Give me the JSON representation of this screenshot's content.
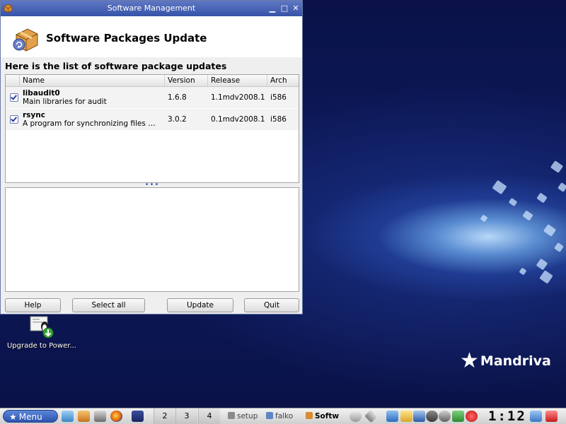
{
  "window": {
    "title": "Software Management",
    "minimize_glyph": "▁",
    "maximize_glyph": "□",
    "close_glyph": "✕"
  },
  "header": {
    "title": "Software Packages Update"
  },
  "list": {
    "subtitle": "Here is the list of software package updates",
    "columns": [
      "Name",
      "Version",
      "Release",
      "Arch"
    ],
    "rows": [
      {
        "checked": true,
        "name": "libaudit0",
        "description": "Main libraries for audit",
        "version": "1.6.8",
        "release": "1.1mdv2008.1",
        "arch": "i586"
      },
      {
        "checked": true,
        "name": "rsync",
        "description": "A program for synchronizing files ov...",
        "version": "3.0.2",
        "release": "0.1mdv2008.1",
        "arch": "i586"
      }
    ],
    "splitter_glyph": "•••"
  },
  "buttons": {
    "help": "Help",
    "select_all": "Select all",
    "update": "Update",
    "quit": "Quit"
  },
  "desktop": {
    "icon_label": "Upgrade to Power...",
    "logo_star": "★",
    "logo_text": "Mandriva"
  },
  "taskbar": {
    "menu_star": "★",
    "menu_label": "Menu",
    "workspaces": [
      "2",
      "3",
      "4"
    ],
    "tasks": [
      "setup",
      "falko",
      "Softw"
    ],
    "clock": "1:12"
  },
  "colors": {
    "titlebar": "#3653a8",
    "accent": "#2d52ae",
    "desktop": "#0b1450"
  }
}
